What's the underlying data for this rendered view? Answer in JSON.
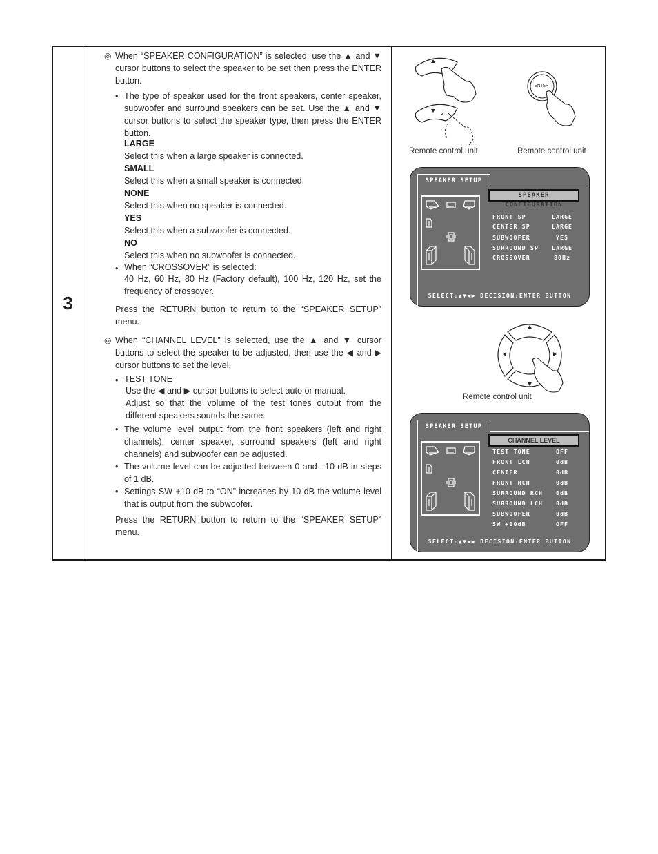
{
  "step_number": "3",
  "left_column": {
    "section1": {
      "marker": "◎",
      "lead": "When “SPEAKER CONFIGURATION” is selected, use the ▲ and ▼ cursor buttons to select the speaker to be set then press the ENTER button.",
      "bullet1": "The type of speaker used for the front speakers, center speaker, subwoofer and surround speakers can be set. Use the ▲ and ▼ cursor buttons to select the speaker type, then press the ENTER button.",
      "options": [
        {
          "name": "LARGE",
          "desc": "Select this when a large speaker is connected."
        },
        {
          "name": "SMALL",
          "desc": "Select this when a small speaker is connected."
        },
        {
          "name": "NONE",
          "desc": "Select this when no speaker is connected."
        },
        {
          "name": "YES",
          "desc": "Select this when a subwoofer is connected."
        },
        {
          "name": "NO",
          "desc": "Select this when no subwoofer is connected."
        }
      ],
      "bullet2_title": "When “CROSSOVER” is selected:",
      "bullet2_body": "40 Hz, 60 Hz, 80 Hz (Factory default), 100 Hz, 120 Hz, set the frequency of crossover.",
      "return_note": "Press the RETURN button to return to the “SPEAKER SETUP” menu."
    },
    "section2": {
      "marker": "◎",
      "lead": "When “CHANNEL LEVEL” is selected, use the ▲ and ▼ cursor buttons to select the speaker to be adjusted, then use the ◀ and ▶ cursor buttons to set the level.",
      "bullet1_title": "TEST TONE",
      "bullet1_line1": "Use the ◀ and ▶ cursor buttons to select auto or manual.",
      "bullet1_line2": "Adjust so that the volume of the test tones output from the different speakers sounds the same.",
      "bullet2": "The volume level output from the front speakers (left and right channels), center speaker, surround speakers (left and right channels) and subwoofer can be adjusted.",
      "bullet3": "The volume level can be adjusted between 0 and –10 dB in steps of 1 dB.",
      "bullet4": "Settings SW +10 dB to “ON” increases by 10 dB the volume level that is output from the subwoofer.",
      "return_note": "Press the RETURN button to return to the “SPEAKER SETUP” menu."
    }
  },
  "figures": {
    "remote_caption_updown": "Remote control unit",
    "remote_caption_enter": "Remote control unit",
    "enter_label": "ENTER",
    "remote_caption_dpad": "Remote control unit",
    "osd1": {
      "tab": "SPEAKER SETUP",
      "title": "SPEAKER CONFIGURATION",
      "rows": [
        {
          "label": "FRONT SP",
          "value": "LARGE"
        },
        {
          "label": "CENTER SP",
          "value": "LARGE"
        },
        {
          "label": "SUBWOOFER",
          "value": "YES"
        },
        {
          "label": "SURROUND SP",
          "value": "LARGE"
        },
        {
          "label": "CROSSOVER",
          "value": "80Hz"
        }
      ],
      "footer": "SELECT:▲▼◀▶ DECISION:ENTER BUTTON"
    },
    "osd2": {
      "tab": "SPEAKER SETUP",
      "title": "CHANNEL LEVEL",
      "rows": [
        {
          "label": "TEST TONE",
          "value": "OFF"
        },
        {
          "label": "FRONT LCH",
          "value": "0dB"
        },
        {
          "label": "CENTER",
          "value": "0dB"
        },
        {
          "label": "FRONT RCH",
          "value": "0dB"
        },
        {
          "label": "SURROUND RCH",
          "value": "0dB"
        },
        {
          "label": "SURROUND LCH",
          "value": "0dB"
        },
        {
          "label": "SUBWOOFER",
          "value": "0dB"
        },
        {
          "label": "SW +10dB",
          "value": "OFF"
        }
      ],
      "footer": "SELECT:▲▼◀▶ DECISION:ENTER BUTTON"
    }
  }
}
